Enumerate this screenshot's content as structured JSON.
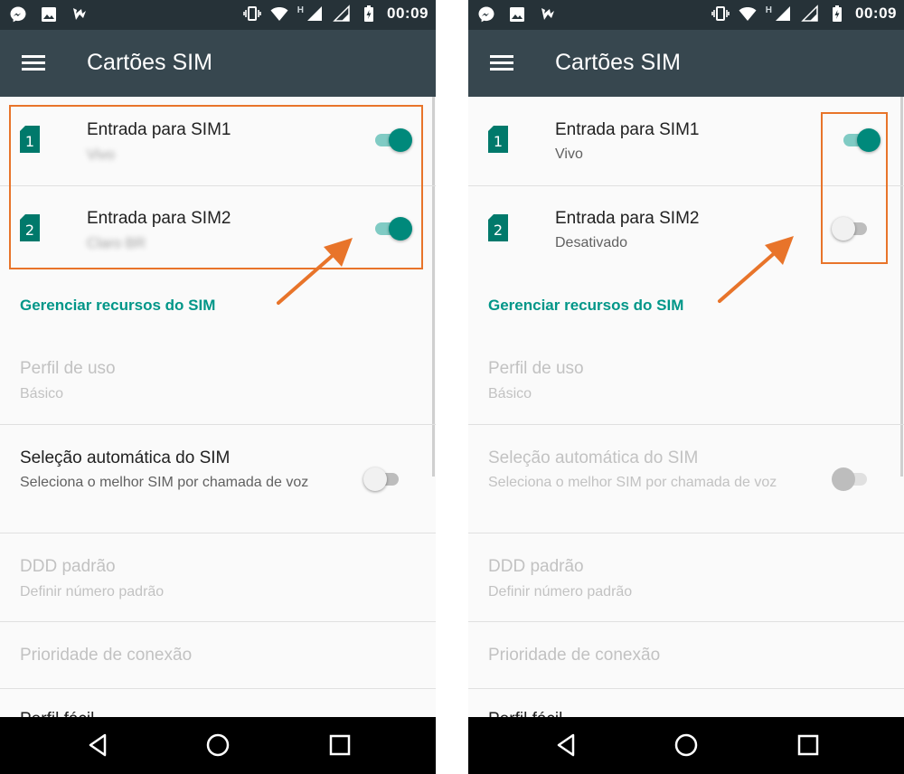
{
  "status_bar": {
    "time": "00:09",
    "network_label": "H"
  },
  "app_bar": {
    "title": "Cartões SIM"
  },
  "left_panel": {
    "sims": [
      {
        "slot": "1",
        "title": "Entrada para SIM1",
        "subtitle": "Vivo",
        "enabled": true
      },
      {
        "slot": "2",
        "title": "Entrada para SIM2",
        "subtitle": "Claro BR",
        "enabled": true
      }
    ]
  },
  "right_panel": {
    "sims": [
      {
        "slot": "1",
        "title": "Entrada para SIM1",
        "subtitle": "Vivo",
        "enabled": true
      },
      {
        "slot": "2",
        "title": "Entrada para SIM2",
        "subtitle": "Desativado",
        "enabled": false
      }
    ]
  },
  "section": {
    "header": "Gerenciar recursos do SIM"
  },
  "prefs": {
    "usage_profile": {
      "title": "Perfil de uso",
      "subtitle": "Básico"
    },
    "auto_select": {
      "title": "Seleção automática do SIM",
      "subtitle": "Seleciona o melhor SIM por chamada de voz",
      "enabled": false
    },
    "default_ddd": {
      "title": "DDD padrão",
      "subtitle": "Definir número padrão"
    },
    "connection_priority": {
      "title": "Prioridade de conexão"
    },
    "cutoff_item": {
      "title": "Perfil fácil"
    }
  },
  "colors": {
    "accent": "#009688",
    "highlight": "#e8742a",
    "app_bar": "#37474f",
    "status_bar": "#263238"
  },
  "icons": [
    "messenger-icon",
    "image-icon",
    "notification-icon",
    "vibrate-icon",
    "wifi-icon",
    "signal-icon",
    "battery-icon",
    "menu-icon",
    "sim-card-icon",
    "back-icon",
    "home-icon",
    "recents-icon"
  ]
}
